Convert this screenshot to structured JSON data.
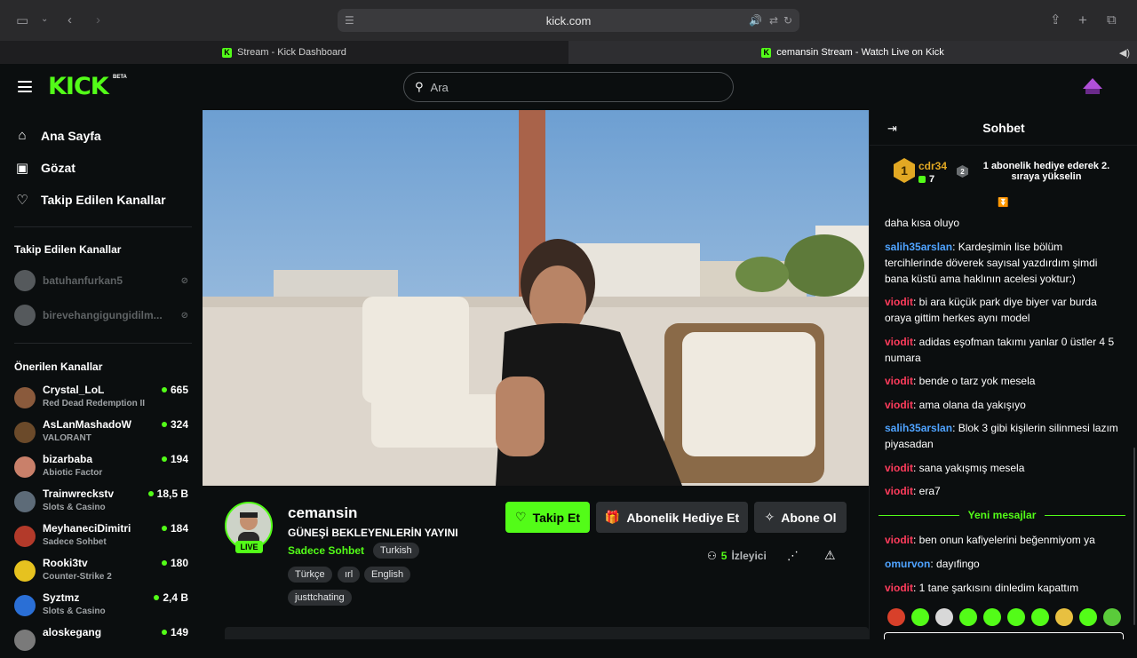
{
  "browser": {
    "url": "kick.com",
    "tabs": [
      {
        "label": "Stream - Kick Dashboard",
        "active": false
      },
      {
        "label": "cemansin Stream - Watch Live on Kick",
        "active": true
      }
    ]
  },
  "header": {
    "logo": "KICK",
    "logo_badge": "BETA",
    "search_placeholder": "Ara"
  },
  "sidebar": {
    "nav": [
      {
        "label": "Ana Sayfa",
        "icon": "home-icon"
      },
      {
        "label": "Gözat",
        "icon": "browse-icon"
      },
      {
        "label": "Takip Edilen Kanallar",
        "icon": "heart-icon"
      }
    ],
    "followed_title": "Takip Edilen Kanallar",
    "followed": [
      {
        "name": "batuhanfurkan5"
      },
      {
        "name": "birevehangigungidilm..."
      }
    ],
    "recommended_title": "Önerilen Kanallar",
    "recommended": [
      {
        "name": "Crystal_LoL",
        "category": "Red Dead Redemption II",
        "viewers": "665",
        "color": "#8a5a3c"
      },
      {
        "name": "AsLanMashadoW",
        "category": "VALORANT",
        "viewers": "324",
        "color": "#6b4a2a"
      },
      {
        "name": "bizarbaba",
        "category": "Abiotic Factor",
        "viewers": "194",
        "color": "#c9806a"
      },
      {
        "name": "Trainwreckstv",
        "category": "Slots & Casino",
        "viewers": "18,5 B",
        "color": "#5d6b78"
      },
      {
        "name": "MeyhaneciDimitri",
        "category": "Sadece Sohbet",
        "viewers": "184",
        "color": "#b33a2a"
      },
      {
        "name": "Rooki3tv",
        "category": "Counter-Strike 2",
        "viewers": "180",
        "color": "#e6c21f"
      },
      {
        "name": "Syztmz",
        "category": "Slots & Casino",
        "viewers": "2,4 B",
        "color": "#2a6fd6"
      },
      {
        "name": "aloskegang",
        "category": "",
        "viewers": "149",
        "color": "#7a7a7a"
      }
    ]
  },
  "stream": {
    "channel": "cemansin",
    "title": "GÜNEŞİ BEKLEYENLERİN YAYINI",
    "category": "Sadece Sohbet",
    "category_tag": "Turkish",
    "tags": [
      "Türkçe",
      "ırl",
      "English",
      "justtchating"
    ],
    "live_label": "LIVE",
    "follow_label": "Takip Et",
    "gift_label": "Abonelik Hediye Et",
    "subscribe_label": "Abone Ol",
    "viewers_count": "5",
    "viewers_label": "İzleyici"
  },
  "chat": {
    "title": "Sohbet",
    "pinned": {
      "rank": "1",
      "user": "cdr34",
      "count": "7",
      "rank2": "2",
      "text": "1 abonelik hediye ederek 2. sıraya yükselin"
    },
    "messages": [
      {
        "user": "",
        "text": "daha kısa oluyo",
        "color": "red"
      },
      {
        "user": "salih35arslan",
        "text": "Kardeşimin lise bölüm tercihlerinde döverek sayısal yazdırdım şimdi bana küstü ama haklının acelesi yoktur:)",
        "color": "blue"
      },
      {
        "user": "viodit",
        "text": "bi ara küçük park diye biyer var burda oraya gittim herkes aynı model",
        "color": "red"
      },
      {
        "user": "viodit",
        "text": "adidas eşofman takımı yanlar 0 üstler 4 5 numara",
        "color": "red"
      },
      {
        "user": "viodit",
        "text": "bende o tarz yok mesela",
        "color": "red"
      },
      {
        "user": "viodit",
        "text": "ama olana da yakışıyo",
        "color": "red"
      },
      {
        "user": "salih35arslan",
        "text": "Blok 3 gibi kişilerin silinmesi lazım piyasadan",
        "color": "blue"
      },
      {
        "user": "viodit",
        "text": "sana yakışmış mesela",
        "color": "red"
      },
      {
        "user": "viodit",
        "text": "era7",
        "color": "red"
      }
    ],
    "new_messages_label": "Yeni mesajlar",
    "new_messages": [
      {
        "user": "viodit",
        "text": "ben onun kafiyelerini beğenmiyom ya",
        "color": "red"
      },
      {
        "user": "omurvon",
        "text": "dayıfingo",
        "color": "blue"
      },
      {
        "user": "viodit",
        "text": "1 tane şarkısını dinledim kapattım",
        "color": "red"
      }
    ]
  }
}
